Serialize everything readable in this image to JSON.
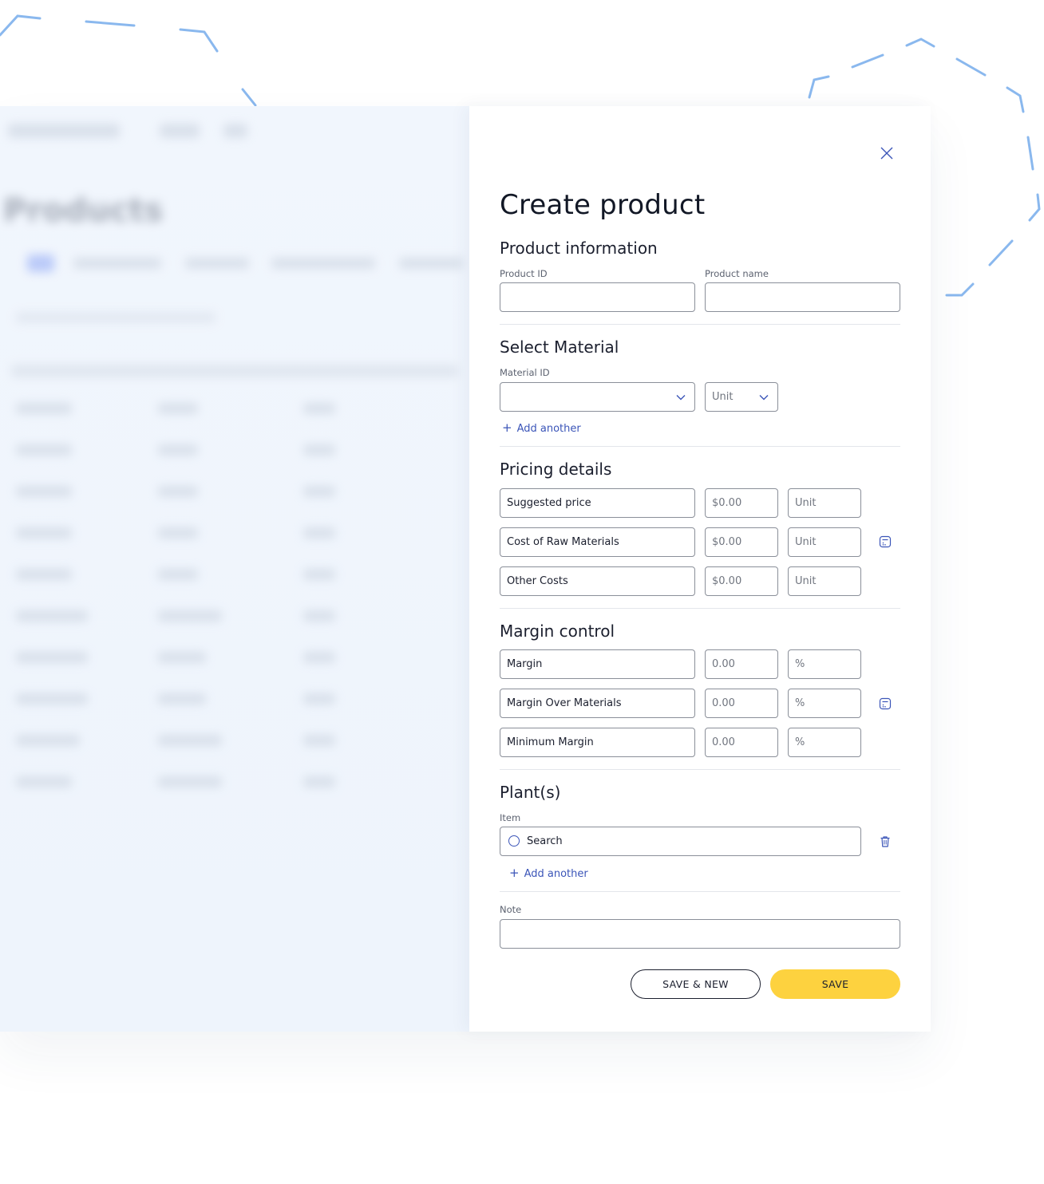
{
  "modal": {
    "title": "Create product",
    "product_info": {
      "heading": "Product information",
      "product_id_label": "Product ID",
      "product_id_value": "",
      "product_name_label": "Product name",
      "product_name_value": ""
    },
    "material": {
      "heading": "Select Material",
      "material_id_label": "Material ID",
      "material_id_value": "",
      "unit_value": "Unit",
      "add_another": "Add another"
    },
    "pricing": {
      "heading": "Pricing details",
      "rows": [
        {
          "label": "Suggested price",
          "amount": "$0.00",
          "unit": "Unit"
        },
        {
          "label": "Cost of Raw Materials",
          "amount": "$0.00",
          "unit": "Unit"
        },
        {
          "label": "Other Costs",
          "amount": "$0.00",
          "unit": "Unit"
        }
      ]
    },
    "margin": {
      "heading": "Margin control",
      "rows": [
        {
          "label": "Margin",
          "amount": "0.00",
          "unit": "%"
        },
        {
          "label": "Margin Over Materials",
          "amount": "0.00",
          "unit": "%"
        },
        {
          "label": "Minimum Margin",
          "amount": "0.00",
          "unit": "%"
        }
      ]
    },
    "plants": {
      "heading": "Plant(s)",
      "item_label": "Item",
      "search_placeholder": "Search",
      "add_another": "Add another"
    },
    "note": {
      "label": "Note",
      "value": ""
    },
    "buttons": {
      "save_new": "SAVE & NEW",
      "save": "SAVE"
    }
  },
  "background": {
    "page_title": "Products"
  },
  "colors": {
    "accent_blue": "#3b55b8",
    "save_yellow": "#fdd23f",
    "deco_dash": "#8ab8ee"
  },
  "icons": {
    "close": "close-icon",
    "chevron": "chevron-down-icon",
    "calculator": "calculator-icon",
    "trash": "trash-icon",
    "search": "search-icon",
    "plus": "plus-icon"
  }
}
